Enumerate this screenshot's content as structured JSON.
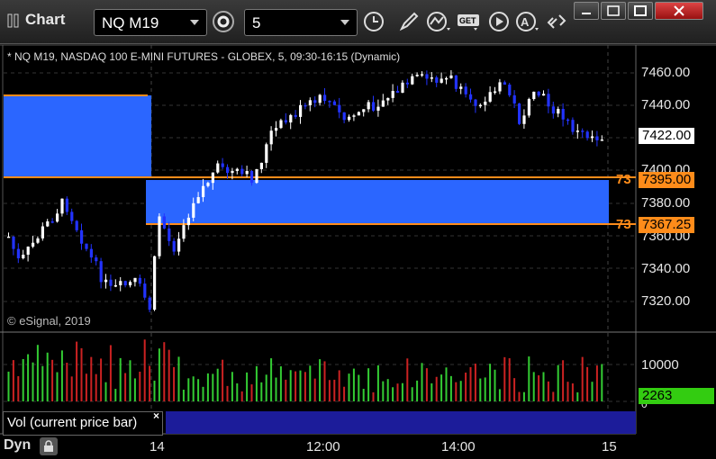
{
  "window": {
    "title": "Chart"
  },
  "toolbar": {
    "symbol": "NQ M19",
    "interval": "5",
    "icons": [
      "settings-gear-icon",
      "clock-icon",
      "pencil-draw-icon",
      "study-icon",
      "get-data-icon",
      "play-icon",
      "alert-icon",
      "link-icon"
    ]
  },
  "chart": {
    "description": "* NQ M19, NASDAQ 100 E-MINI FUTURES - GLOBEX, 5, 09:30-16:15 (Dynamic)",
    "copyright": "© eSignal, 2019",
    "price_axis": [
      "7460.00",
      "7440.00",
      "7422.00",
      "7400.00",
      "7395.00",
      "7380.00",
      "7367.25",
      "7360.00",
      "7340.00",
      "7320.00"
    ],
    "last_price": "7422.00",
    "zone_tags": [
      {
        "short": "73",
        "price": "7395.00"
      },
      {
        "short": "73",
        "price": "7367.25"
      }
    ],
    "time_axis": [
      "14",
      "12:00",
      "14:00",
      "15"
    ],
    "colors": {
      "zone_fill": "#2b66ff",
      "zone_line": "#ff8c1a",
      "up_candle": "#ffffff",
      "down_candle": "#2233ff",
      "vol_up": "#33cc33",
      "vol_down": "#cc2222",
      "last_volume_bg": "#33cc11"
    }
  },
  "volume": {
    "axis": [
      "10000",
      "0"
    ],
    "last_volume": "2263",
    "panel_label": "Vol (current price bar)",
    "close_symbol": "×"
  },
  "footer": {
    "mode": "Dyn"
  }
}
